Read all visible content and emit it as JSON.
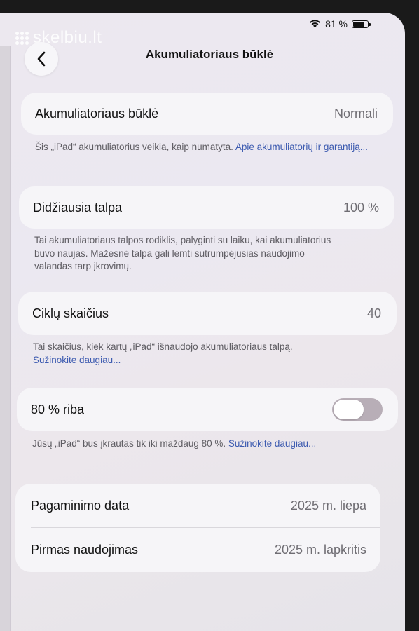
{
  "watermark": "skelbiu.lt",
  "status_bar": {
    "battery_percent": "81 %"
  },
  "nav": {
    "title": "Akumuliatoriaus būklė"
  },
  "battery_health": {
    "label": "Akumuliatoriaus būklė",
    "value": "Normali",
    "note_text": "Šis „iPad“ akumuliatorius veikia, kaip numatyta. ",
    "note_link": "Apie akumuliatorių ir garantiją..."
  },
  "max_capacity": {
    "label": "Didžiausia talpa",
    "value": "100 %",
    "note_line1": "Tai akumuliatoriaus talpos rodiklis, palyginti su laiku, kai akumuliatorius",
    "note_line2": "buvo naujas. Mažesnė talpa gali lemti sutrumpėjusias naudojimo",
    "note_line3": "valandas tarp įkrovimų."
  },
  "cycle_count": {
    "label": "Ciklų skaičius",
    "value": "40",
    "note_text": "Tai skaičius, kiek kartų „iPad“ išnaudojo akumuliatoriaus talpą.",
    "note_link": "Sužinokite daugiau..."
  },
  "limit_80": {
    "label": "80 % riba",
    "toggle_on": false,
    "note_text": "Jūsų „iPad“ bus įkrautas tik iki maždaug 80 %. ",
    "note_link": "Sužinokite daugiau..."
  },
  "info": {
    "manufacture_label": "Pagaminimo data",
    "manufacture_value": "2025 m. liepa",
    "first_use_label": "Pirmas naudojimas",
    "first_use_value": "2025 m. lapkritis"
  },
  "colors": {
    "link": "#3d5bb0",
    "toggle_off": "#b8aeb7",
    "card_bg": "#f6f5f8"
  }
}
